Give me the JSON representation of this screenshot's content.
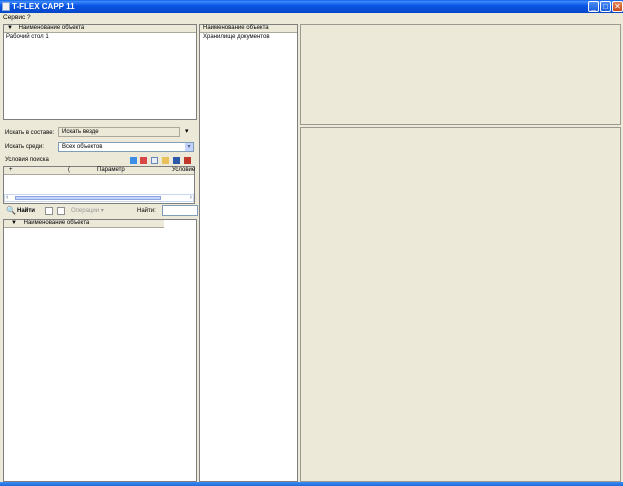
{
  "window": {
    "title": "T-FLEX CAPP 11",
    "buttons": {
      "minimize": "_",
      "maximize": "□",
      "close": "✕"
    }
  },
  "menu": {
    "items": [
      "Сервис",
      "?"
    ]
  },
  "tree_panel": {
    "header": "Наименование объекта",
    "items": [
      "Рабочий стол 1"
    ]
  },
  "search": {
    "in_label": "Искать в составе:",
    "in_value": "Искать везде",
    "among_label": "Искать среди:",
    "among_value": "Всех объектов",
    "conditions_label": "Условия поиска",
    "columns": [
      "+",
      "(",
      "Параметр",
      "Условие"
    ],
    "find_button": "Найти",
    "operations_button": "Операции",
    "find_label": "Найти:",
    "find_value": ""
  },
  "results_panel": {
    "header": "Наименование объекта"
  },
  "middle_panel": {
    "header": "Наименование объекта",
    "items": [
      "Хранилище документов"
    ]
  },
  "colors": {
    "titlebar": "#0a5ae8",
    "background": "#ece9d8",
    "panel": "#ffffff"
  },
  "icons": [
    "search-icon",
    "toolbar-icon"
  ]
}
